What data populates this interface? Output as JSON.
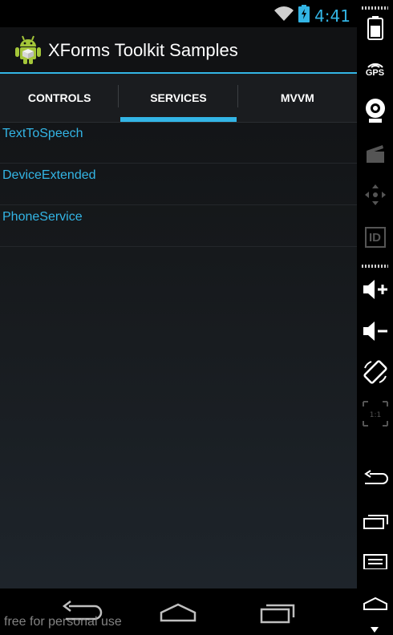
{
  "status_bar": {
    "time": "4:41",
    "icons": [
      "wifi-icon",
      "battery-charging-icon"
    ],
    "accent_color": "#33b5e5"
  },
  "action_bar": {
    "title": "XForms Toolkit Samples",
    "icon": "android-icon"
  },
  "tabs": [
    {
      "label": "CONTROLS",
      "selected": false
    },
    {
      "label": "SERVICES",
      "selected": true
    },
    {
      "label": "MVVM",
      "selected": false
    }
  ],
  "list_items": [
    {
      "label": "TextToSpeech"
    },
    {
      "label": "DeviceExtended"
    },
    {
      "label": "PhoneService"
    }
  ],
  "nav_bar": {
    "buttons": [
      "back-icon",
      "home-icon",
      "recents-icon"
    ]
  },
  "watermark": "free for personal use",
  "emulator_panel": {
    "gps_label": "GPS",
    "id_label": "ID",
    "scale_label": "1:1",
    "buttons": [
      "battery-icon",
      "gps-icon",
      "camera-icon",
      "video-icon",
      "dpad-icon",
      "id-icon",
      "volume-up-icon",
      "volume-down-icon",
      "rotate-icon",
      "scale-icon",
      "back-icon",
      "recents-icon",
      "menu-icon",
      "home-icon"
    ]
  }
}
